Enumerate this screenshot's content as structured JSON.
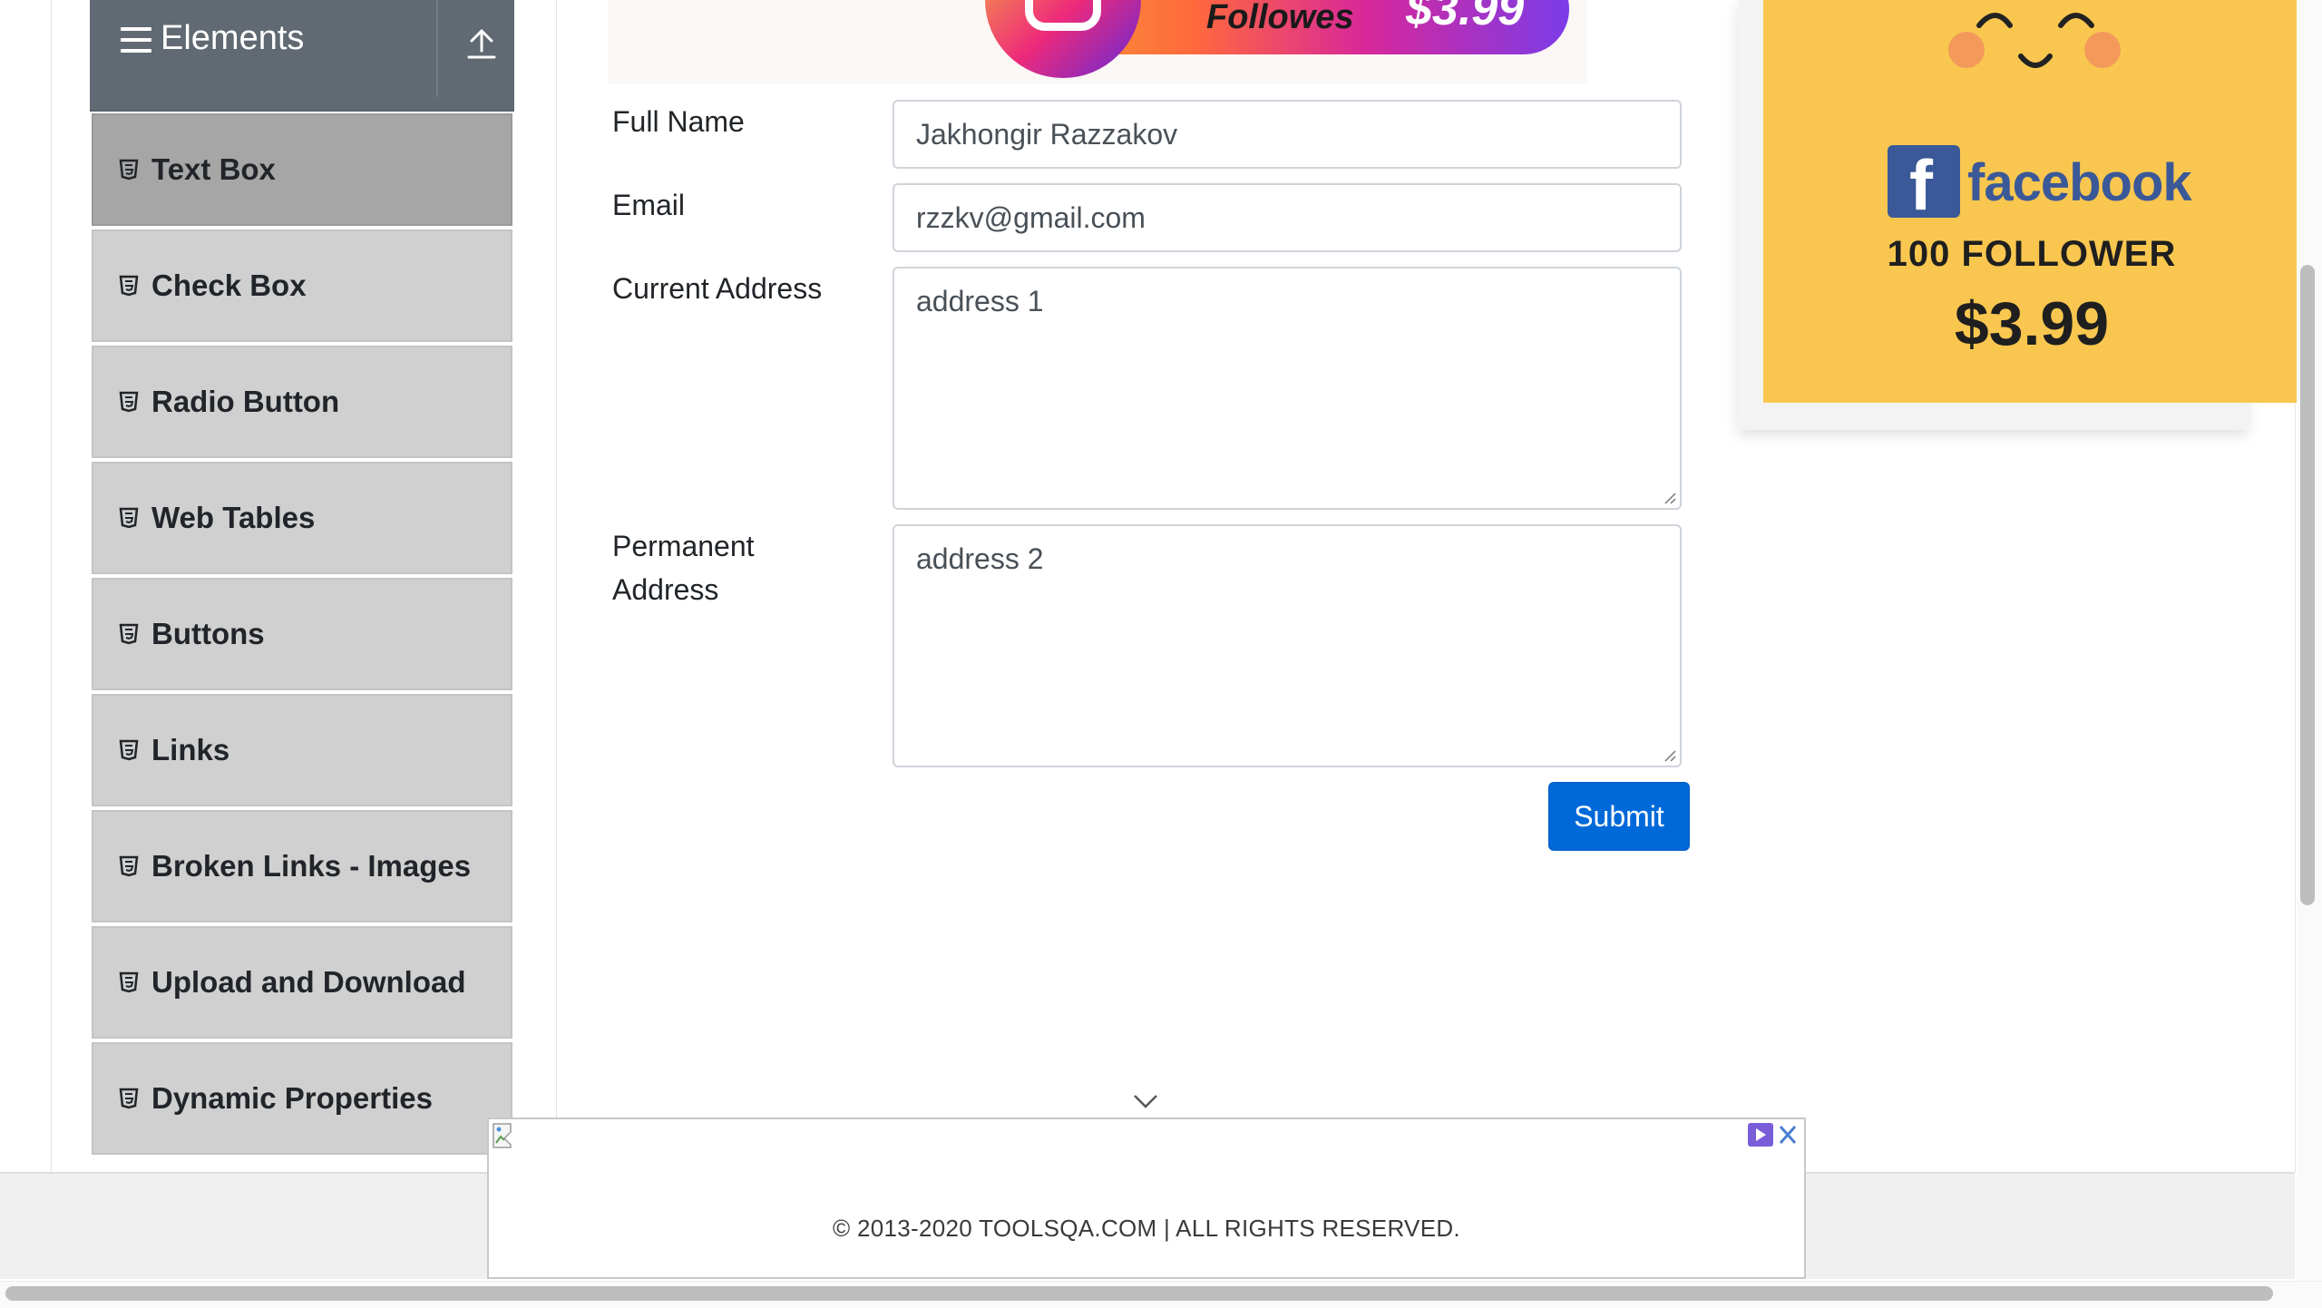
{
  "sidebar": {
    "group_title": "Elements",
    "items": [
      {
        "label": "Text Box",
        "active": true
      },
      {
        "label": "Check Box",
        "active": false
      },
      {
        "label": "Radio Button",
        "active": false
      },
      {
        "label": "Web Tables",
        "active": false
      },
      {
        "label": "Buttons",
        "active": false
      },
      {
        "label": "Links",
        "active": false
      },
      {
        "label": "Broken Links - Images",
        "active": false
      },
      {
        "label": "Upload and Download",
        "active": false
      },
      {
        "label": "Dynamic Properties",
        "active": false
      }
    ]
  },
  "top_ad": {
    "text": "Followes",
    "price": "$3.99"
  },
  "side_ad": {
    "brand": "facebook",
    "brand_initial": "f",
    "followers": "100 FOLLOWER",
    "price": "$3.99"
  },
  "form": {
    "full_name": {
      "label": "Full Name",
      "value": "Jakhongir Razzakov"
    },
    "email": {
      "label": "Email",
      "value": "rzzkv@gmail.com"
    },
    "current_address": {
      "label": "Current Address",
      "value": "address 1"
    },
    "permanent_address": {
      "label_line1": "Permanent",
      "label_line2": "Address",
      "value": "address 2"
    },
    "submit_label": "Submit"
  },
  "footer": {
    "text": "© 2013-2020 TOOLSQA.COM | ALL RIGHTS RESERVED."
  },
  "colors": {
    "primary_button": "#0069d9",
    "sidebar_header": "#616a73",
    "sidebar_item": "#d0d0d0",
    "sidebar_item_active": "#a6a6a6",
    "ad_yellow": "#f9c74f",
    "facebook_blue": "#3b5998"
  }
}
